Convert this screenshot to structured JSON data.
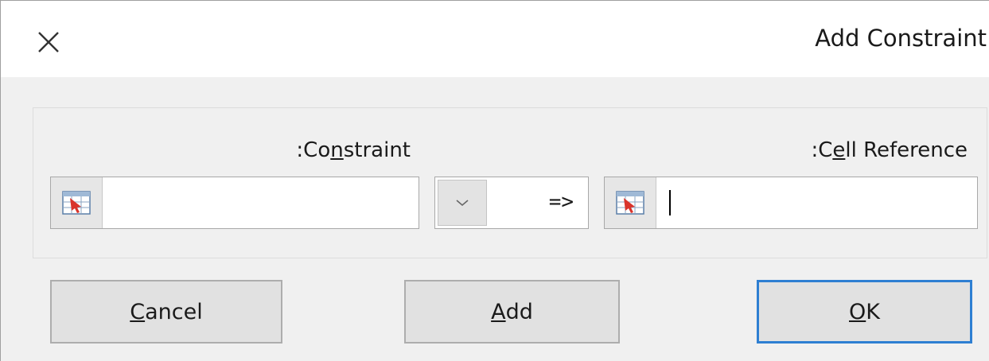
{
  "dialog": {
    "title": "Add Constraint",
    "close_icon": "close-x-icon"
  },
  "fields": {
    "constraint": {
      "label_prefix": ":Co",
      "label_accel": "n",
      "label_suffix": "straint",
      "value": "",
      "ref_icon": "range-select-icon"
    },
    "operator": {
      "selected": "=>",
      "arrow_icon": "chevron-down-icon"
    },
    "cell_reference": {
      "label_prefix": ":C",
      "label_accel": "e",
      "label_suffix": "ll Reference",
      "value": "",
      "ref_icon": "range-select-icon"
    }
  },
  "buttons": {
    "cancel": {
      "accel": "C",
      "rest": "ancel"
    },
    "add": {
      "accel": "A",
      "rest": "dd"
    },
    "ok": {
      "accel": "O",
      "rest": "K"
    }
  },
  "colors": {
    "dialog_bg": "#f0f0f0",
    "titlebar_bg": "#ffffff",
    "ok_border": "#2e7fd2"
  }
}
